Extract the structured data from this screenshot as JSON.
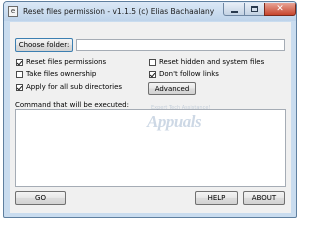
{
  "window": {
    "title": "Reset files permission - v1.1.5 (c) Elias Bachaalany",
    "app_icon": "e"
  },
  "folder": {
    "button_label": "Choose folder:",
    "value": ""
  },
  "options": {
    "reset_permissions": {
      "label": "Reset files permissions",
      "checked": true
    },
    "take_ownership": {
      "label": "Take files ownership",
      "checked": false
    },
    "apply_subdirs": {
      "label": "Apply for all sub directories",
      "checked": true
    },
    "reset_hidden_system": {
      "label": "Reset hidden and system files",
      "checked": false
    },
    "dont_follow_links": {
      "label": "Don't follow links",
      "checked": true
    }
  },
  "advanced_button": "Advanced",
  "command": {
    "label": "Command that will be executed:",
    "value": ""
  },
  "watermark": {
    "small": "Expert Tech Assistance!",
    "big": "Appuals"
  },
  "buttons": {
    "go": "GO",
    "help": "HELP",
    "about": "ABOUT"
  }
}
